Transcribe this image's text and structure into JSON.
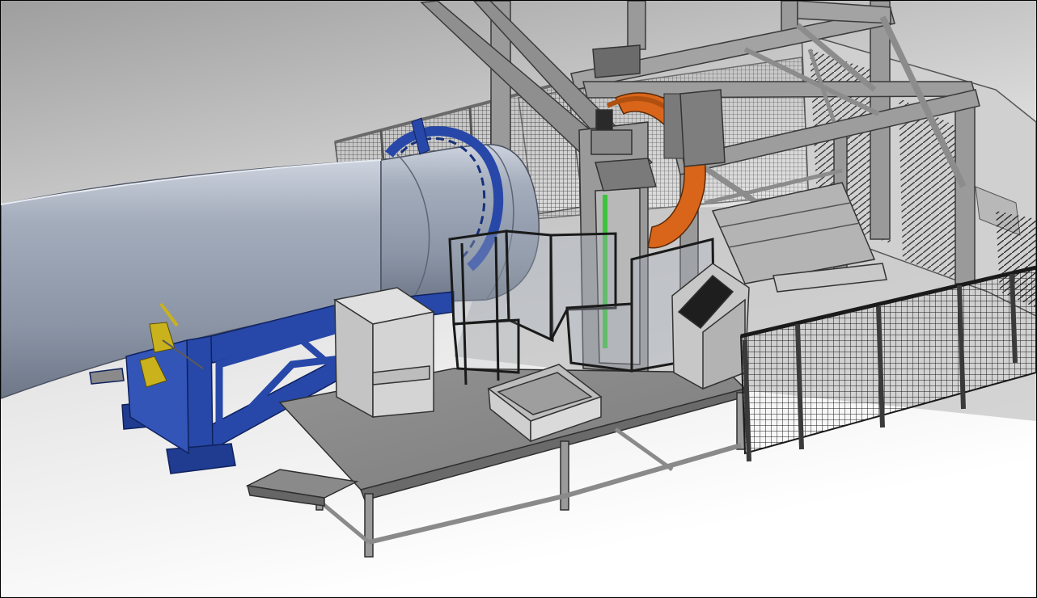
{
  "viewport": {
    "background_top": "#9c9c9c",
    "background_bottom": "#ffffff",
    "border_color": "#000000"
  },
  "colors": {
    "blade_shell": "#8e98a8",
    "blade_light": "#cdd3de",
    "blade_dark": "#6e7788",
    "support_blue": "#2748a8",
    "support_blue_dark": "#17307a",
    "ring_orange": "#d9651a",
    "steel_frame": "#8c8c8c",
    "steel_dark": "#4a4a4a",
    "platform_gray": "#8a8a8a",
    "fence_mesh": "#1a1a1a",
    "cabinet_gray": "#c7c7c7",
    "screen_black": "#1e1e1e",
    "indicator_green": "#3cc43c",
    "clamp_yellow": "#c9b21c"
  },
  "icons": {
    "blade": "wind-turbine-blade-icon",
    "blade_support": "blade-support-cradle-icon",
    "clamp": "root-clamp-icon",
    "ring": "drilling-ring-icon",
    "gantry": "gantry-frame-icon",
    "platform": "work-platform-icon",
    "fence": "safety-fence-icon",
    "terminal": "control-terminal-icon",
    "cabinet": "electrical-cabinet-icon",
    "tray": "parts-tray-icon"
  }
}
